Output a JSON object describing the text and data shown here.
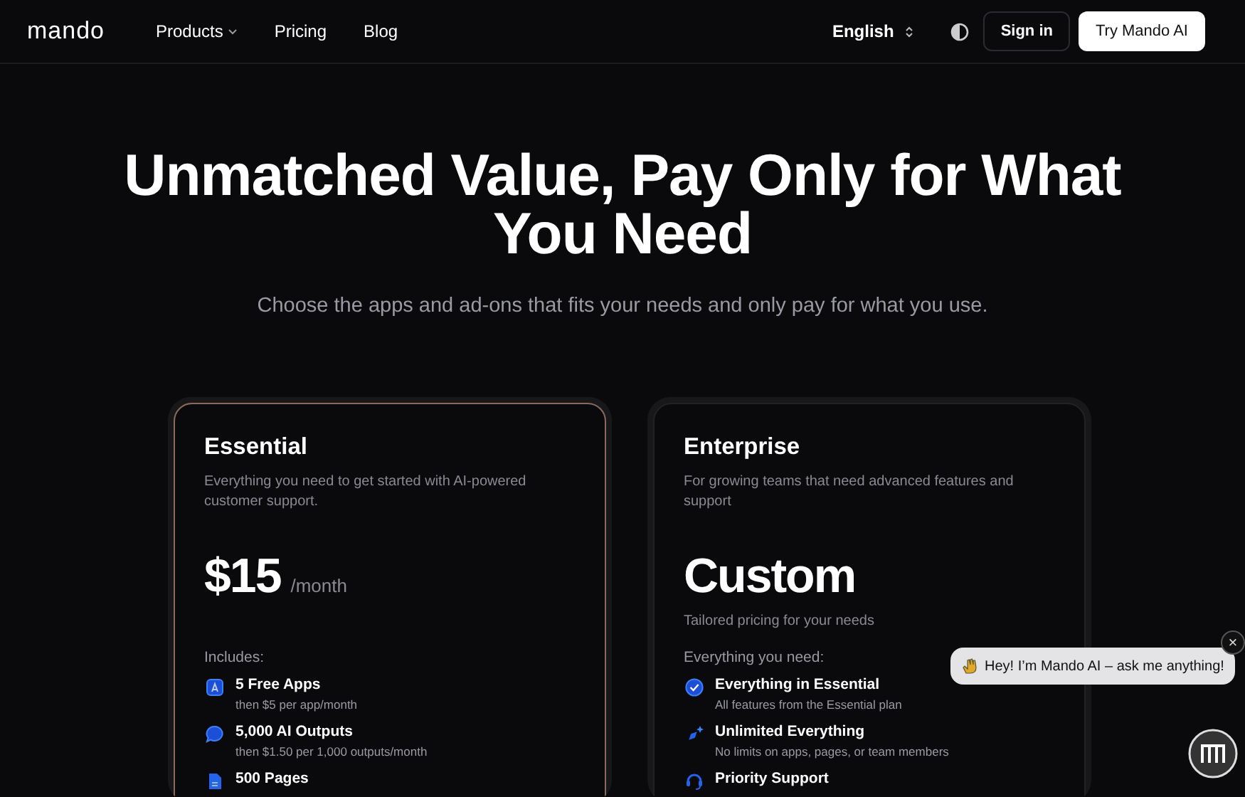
{
  "nav": {
    "logo": "mando",
    "links": [
      {
        "label": "Products",
        "dropdown": true
      },
      {
        "label": "Pricing",
        "dropdown": false
      },
      {
        "label": "Blog",
        "dropdown": false
      }
    ],
    "language": "English",
    "sign_in": "Sign in",
    "cta": "Try Mando AI"
  },
  "hero": {
    "title": "Unmatched Value, Pay Only for What You Need",
    "subtitle": "Choose the apps and ad-ons that fits your needs and only pay for what you use."
  },
  "plans": [
    {
      "name": "Essential",
      "description": "Everything you need to get started with AI-powered customer support.",
      "price": "$15",
      "period": "/month",
      "highlighted": true,
      "features_heading": "Includes:",
      "features": [
        {
          "title": "5 Free Apps",
          "detail": "then $5 per app/month"
        },
        {
          "title": "5,000 AI Outputs",
          "detail": "then $1.50 per 1,000 outputs/month"
        },
        {
          "title": "500 Pages"
        }
      ]
    },
    {
      "name": "Enterprise",
      "description": "For growing teams that need advanced features and support",
      "price": "Custom",
      "note": "Tailored pricing for your needs",
      "highlighted": false,
      "features_heading": "Everything you need:",
      "features": [
        {
          "title": "Everything in Essential",
          "detail": "All features from the Essential plan"
        },
        {
          "title": "Unlimited Everything",
          "detail": "No limits on apps, pages, or team members"
        },
        {
          "title": "Priority Support"
        }
      ]
    }
  ],
  "chat": {
    "greeting": "Hey! I’m Mando AI – ask me anything!",
    "close": "×"
  }
}
